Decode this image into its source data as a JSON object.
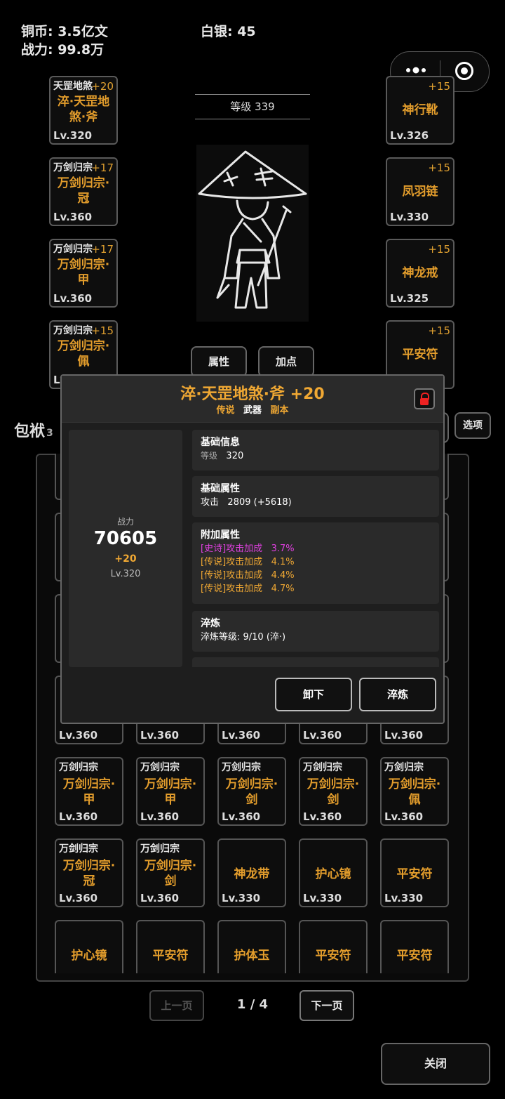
{
  "top": {
    "copper": "铜币: 3.5亿文",
    "silver": "白银: 45",
    "power": "战力: 99.8万"
  },
  "level": "等级 339",
  "left_equips": [
    {
      "set": "天罡地煞",
      "plus": "+20",
      "name": "淬·天罡地煞·斧",
      "lv": "Lv.320"
    },
    {
      "set": "万剑归宗",
      "plus": "+17",
      "name": "万剑归宗·冠",
      "lv": "Lv.360"
    },
    {
      "set": "万剑归宗",
      "plus": "+17",
      "name": "万剑归宗·甲",
      "lv": "Lv.360"
    },
    {
      "set": "万剑归宗",
      "plus": "+15",
      "name": "万剑归宗·佩",
      "lv": "Lv.360"
    }
  ],
  "right_equips": [
    {
      "plus": "+15",
      "name": "神行靴",
      "lv": "Lv.326"
    },
    {
      "plus": "+15",
      "name": "凤羽链",
      "lv": "Lv.330"
    },
    {
      "plus": "+15",
      "name": "神龙戒",
      "lv": "Lv.325"
    },
    {
      "plus": "+15",
      "name": "平安符",
      "lv": ""
    }
  ],
  "buttons": {
    "attributes": "属性",
    "add_points": "加点",
    "options": "选项",
    "close": "关闭"
  },
  "bag": {
    "title": "包袱",
    "count": "3",
    "row4_lv": [
      "Lv.360",
      "Lv.360",
      "Lv.360",
      "Lv.360",
      "Lv.360"
    ],
    "row5": [
      {
        "set": "万剑归宗",
        "name": "万剑归宗·甲",
        "lv": "Lv.360"
      },
      {
        "set": "万剑归宗",
        "name": "万剑归宗·甲",
        "lv": "Lv.360"
      },
      {
        "set": "万剑归宗",
        "name": "万剑归宗·剑",
        "lv": "Lv.360"
      },
      {
        "set": "万剑归宗",
        "name": "万剑归宗·剑",
        "lv": "Lv.360"
      },
      {
        "set": "万剑归宗",
        "name": "万剑归宗·佩",
        "lv": "Lv.360"
      }
    ],
    "row6": [
      {
        "set": "万剑归宗",
        "name": "万剑归宗·冠",
        "lv": "Lv.360"
      },
      {
        "set": "万剑归宗",
        "name": "万剑归宗·剑",
        "lv": "Lv.360"
      },
      {
        "set": "",
        "name": "神龙带",
        "lv": "Lv.330"
      },
      {
        "set": "",
        "name": "护心镜",
        "lv": "Lv.330"
      },
      {
        "set": "",
        "name": "平安符",
        "lv": "Lv.330"
      }
    ],
    "row7": [
      {
        "name": "护心镜"
      },
      {
        "name": "平安符"
      },
      {
        "name": "护体玉"
      },
      {
        "name": "平安符"
      },
      {
        "name": "平安符"
      }
    ]
  },
  "pager": {
    "prev": "上一页",
    "page": "1 / 4",
    "next": "下一页"
  },
  "modal": {
    "title": "淬·天罡地煞·斧 +20",
    "quality": "传说",
    "slot": "武器",
    "source": "副本",
    "power_label": "战力",
    "power_value": "70605",
    "plus": "+20",
    "lv": "Lv.320",
    "base_info_title": "基础信息",
    "base_info_key": "等级",
    "base_info_value": "320",
    "base_attr_title": "基础属性",
    "base_attr_key": "攻击",
    "base_attr_value": "2809 (+5618)",
    "extra_title": "附加属性",
    "extra": [
      {
        "tag": "[史诗]攻击加成",
        "value": "3.7%"
      },
      {
        "tag": "[传说]攻击加成",
        "value": "4.1%"
      },
      {
        "tag": "[传说]攻击加成",
        "value": "4.4%"
      },
      {
        "tag": "[传说]攻击加成",
        "value": "4.7%"
      }
    ],
    "refine_title": "淬炼",
    "refine_text": "淬炼等级: 9/10 (淬·)",
    "unequip": "卸下",
    "refine_btn": "淬炼"
  },
  "colors": {
    "gold": "#e39d2c",
    "epic": "#e040e0",
    "lock": "#e22222"
  }
}
